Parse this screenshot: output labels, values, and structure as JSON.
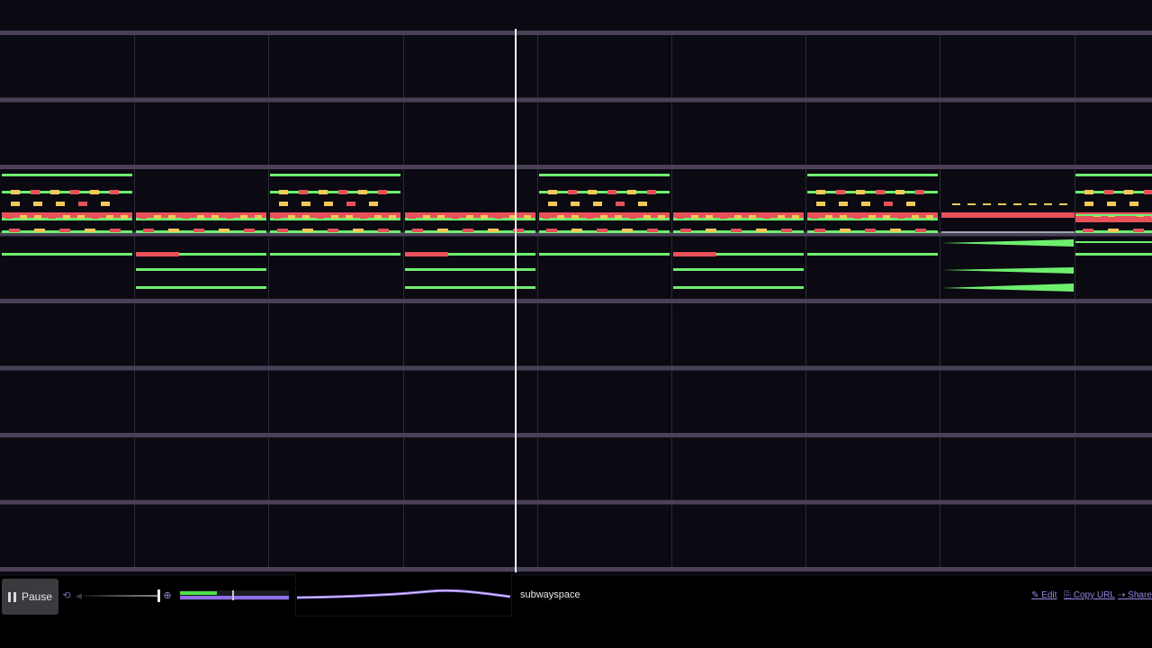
{
  "colors": {
    "background": "#0b0a12",
    "staff_line": "#4a4158",
    "bar_line": "#2c2a36",
    "playhead": "#f4f4f4",
    "note_green": "#6ef06e",
    "note_red": "#e8505a",
    "note_yellow": "#f2c85a",
    "note_gray": "#9ca6a8",
    "accent_purple": "#8f6ee8",
    "link": "#9a86e8"
  },
  "playback": {
    "pause_label": "Pause",
    "volume_level": 0.97,
    "timeline_green_fraction": 0.34,
    "timeline_purple_fraction": 1.0,
    "timeline_marker_fraction": 0.48,
    "playhead_fraction": 0.5
  },
  "song": {
    "title": "subwayspace"
  },
  "links": {
    "edit": "✎ Edit",
    "copy_url": "⎘ Copy URL",
    "share": "⇢ Share"
  },
  "icons": {
    "pause": "pause-icon",
    "loop": "loop-icon",
    "mute": "mute-icon",
    "zoom": "zoom-icon"
  }
}
